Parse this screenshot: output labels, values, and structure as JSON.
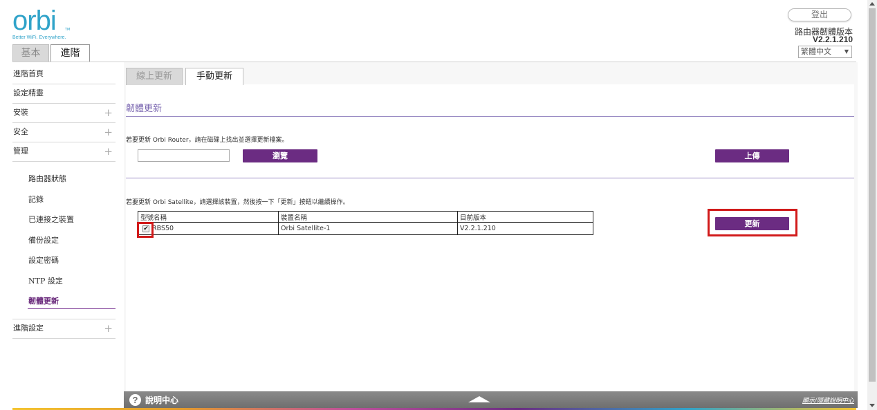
{
  "header": {
    "logo_text": "orbi",
    "logo_tm": "TM",
    "logo_tagline": "Better WiFi. Everywhere.",
    "logout_label": "登出",
    "firmware_label": "路由器韌體版本",
    "firmware_version": "V2.2.1.210",
    "language": "繁體中文"
  },
  "main_tabs": {
    "basic": "基本",
    "advanced": "進階"
  },
  "sidebar": {
    "items": [
      {
        "label": "進階首頁",
        "plus": ""
      },
      {
        "label": "設定精靈",
        "plus": ""
      },
      {
        "label": "安裝",
        "plus": "+"
      },
      {
        "label": "安全",
        "plus": "+"
      },
      {
        "label": "管理",
        "plus": "+"
      }
    ],
    "sub_items": [
      {
        "label": "路由器狀態"
      },
      {
        "label": "記錄"
      },
      {
        "label": "已連接之裝置"
      },
      {
        "label": "備份設定"
      },
      {
        "label": "設定密碼"
      },
      {
        "label": "NTP 設定"
      },
      {
        "label": "韌體更新"
      }
    ],
    "bottom_item": {
      "label": "進階設定",
      "plus": "+"
    }
  },
  "sub_tabs": {
    "online": "線上更新",
    "manual": "手動更新"
  },
  "content": {
    "section_title": "韌體更新",
    "router_instruction": "若要更新 Orbi Router，請在磁碟上找出並選擇更新檔案。",
    "browse_label": "瀏覽",
    "upload_label": "上傳",
    "satellite_instruction": "若要更新 Orbi Satellite，請選擇該裝置，然後按一下「更新」按鈕以繼續操作。",
    "table_headers": {
      "model": "型號名稱",
      "device": "裝置名稱",
      "version": "目前版本"
    },
    "table_rows": [
      {
        "check": "✔",
        "model": "RBS50",
        "device": "Orbi Satellite-1",
        "version": "V2.2.1.210"
      }
    ],
    "update_label": "更新"
  },
  "footer": {
    "help_icon": "?",
    "help_label": "說明中心",
    "help_link": "顯示/隱藏說明中心"
  },
  "colors": {
    "brand_blue": "#30a3c9",
    "button_purple": "#6b2c82",
    "highlight_red": "#d11a1a",
    "section_title": "#7a66b0"
  }
}
